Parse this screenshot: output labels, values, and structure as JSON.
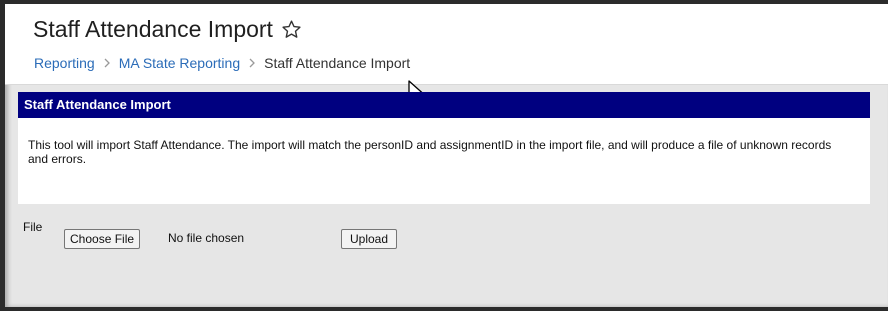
{
  "header": {
    "title": "Staff Attendance Import",
    "favorite_icon": "star-outline-icon",
    "breadcrumb": [
      {
        "label": "Reporting"
      },
      {
        "label": "MA State Reporting"
      },
      {
        "label": "Staff Attendance Import"
      }
    ]
  },
  "panel": {
    "title": "Staff Attendance Import",
    "description": "This tool will import Staff Attendance. The import will match the personID and assignmentID in the import file, and will produce a file of unknown records and errors."
  },
  "form": {
    "file_label": "File",
    "choose_file_label": "Choose File",
    "file_status": "No file chosen",
    "upload_label": "Upload"
  },
  "colors": {
    "panel_header_bg": "#000080",
    "link": "#2b6cb8",
    "background": "#e6e6e6"
  }
}
